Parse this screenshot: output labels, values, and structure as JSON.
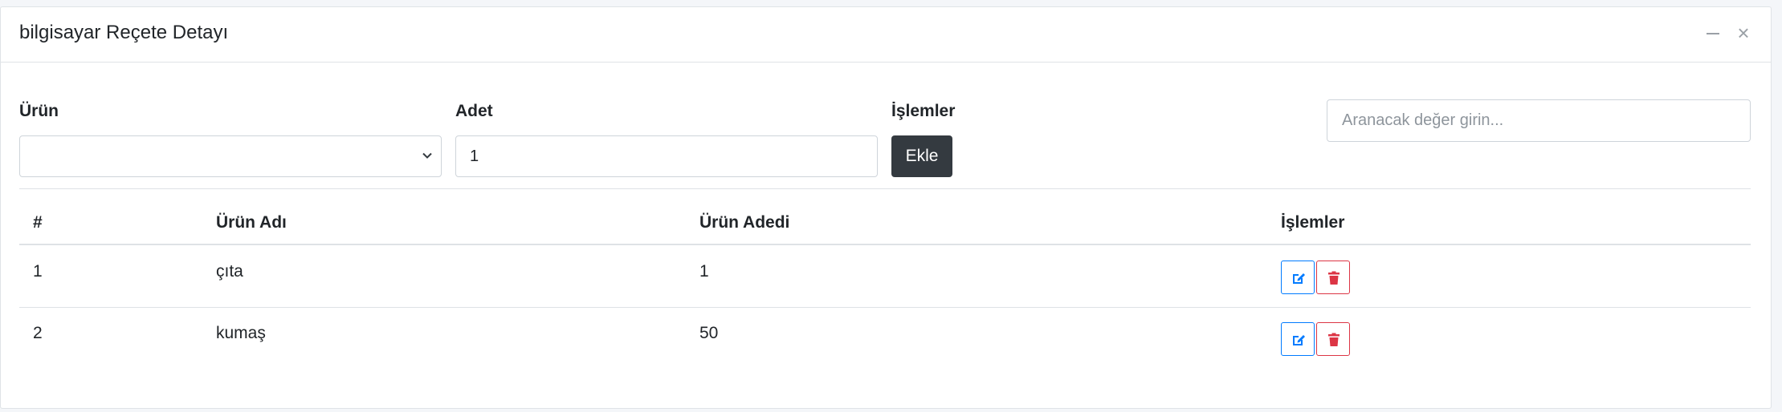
{
  "card": {
    "title": "bilgisayar Reçete Detayı"
  },
  "header_tools": {
    "minimize_icon": "minus-icon",
    "close_icon": "close-icon",
    "close_glyph": "×"
  },
  "form": {
    "product_label": "Ürün",
    "product_selected": "",
    "quantity_label": "Adet",
    "quantity_value": "1",
    "actions_label": "İşlemler",
    "add_button": "Ekle"
  },
  "search": {
    "placeholder": "Aranacak değer girin..."
  },
  "table": {
    "columns": [
      "#",
      "Ürün Adı",
      "Ürün Adedi",
      "İşlemler"
    ],
    "rows": [
      {
        "index": "1",
        "name": "çıta",
        "quantity": "1"
      },
      {
        "index": "2",
        "name": "kumaş",
        "quantity": "50"
      }
    ],
    "row_actions": [
      "edit-icon",
      "trash-icon"
    ]
  },
  "colors": {
    "primary": "#007bff",
    "danger": "#dc3545",
    "dark_button": "#343a40"
  }
}
